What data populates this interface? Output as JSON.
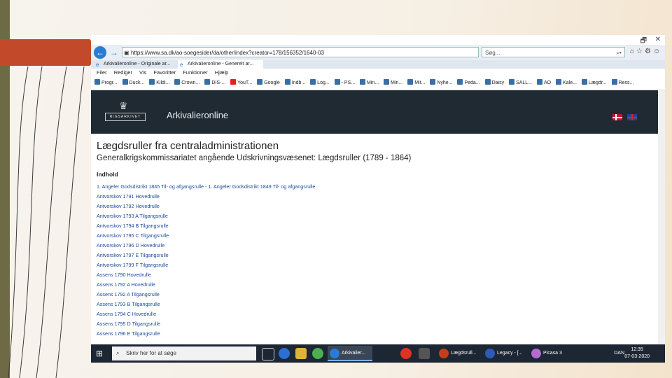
{
  "browser": {
    "url": "https://www.sa.dk/ao-soegesider/da/other/index?creator=178/156352/1640-03",
    "search_placeholder": "Søg...",
    "tabs": [
      {
        "label": "Arkivalieronline - Originale ar..."
      },
      {
        "label": "Arkivalieronline - Generelt ar..."
      }
    ],
    "menu": [
      "Filer",
      "Rediger",
      "Vis",
      "Favoritter",
      "Funktioner",
      "Hjælp"
    ],
    "favorites": [
      "Progr...",
      "Duck...",
      "Kildi...",
      "Crown...",
      "DIS-...",
      "YouT...",
      "Google",
      "Indb...",
      "Log...",
      "- PS...",
      "Min...",
      "Min...",
      "Mit...",
      "Nyhe...",
      "Peda...",
      "Daisy",
      "SALL...",
      "AO",
      "Kale...",
      "Lægdr...",
      "Ress..."
    ]
  },
  "site": {
    "logo_text": "RIGSARKIVET",
    "name": "Arkivalieronline"
  },
  "page": {
    "title": "Lægdsruller fra centraladministrationen",
    "subtitle": "Generalkrigskommissariatet angående Udskrivningsvæsenet: Lægdsruller (1789 - 1864)",
    "contents_heading": "Indhold",
    "links": [
      "1. Angeler Godsdistrikt 1845 Til- og afgangsrulle - 1. Angeler Godsdistrikt 1849 Til- og afgangsrulle",
      "Antvorskov 1791 Hovedrulle",
      "Antvorskov 1792 Hovedrulle",
      "Antvorskov 1793 A Tilgangsrulle",
      "Antvorskov 1794 B Tilgangsrulle",
      "Antvorskov 1795 C Tilgangsrulle",
      "Antvorskov 1796 D Hovedrulle",
      "Antvorskov 1797 E Tilgangsrulle",
      "Antvorskov 1799 F Tilgangsrulle",
      "Assens 1790 Hovedrulle",
      "Assens 1792 A Hovedrulle",
      "Assens 1792 A Tilgangsrulle",
      "Assens 1793 B Tilgangsrulle",
      "Assens 1794 C Hovedrulle",
      "Assens 1795 D Tilgangsrulle",
      "Assens 1796 E Tilgangsrulle"
    ]
  },
  "taskbar": {
    "search_placeholder": "Skriv her for at søge",
    "apps": [
      {
        "label": "Arkivalier..."
      },
      {
        "label": "Lægdsrull..."
      },
      {
        "label": "Legacy - [..."
      },
      {
        "label": "Picasa 3"
      }
    ],
    "language": "DAN",
    "time": "12:35",
    "date": "07-03-2020"
  },
  "colors": {
    "accent": "#c24a2b",
    "site_header": "#1f2a33",
    "link": "#1b4a9b",
    "taskbar": "#1d2633"
  }
}
